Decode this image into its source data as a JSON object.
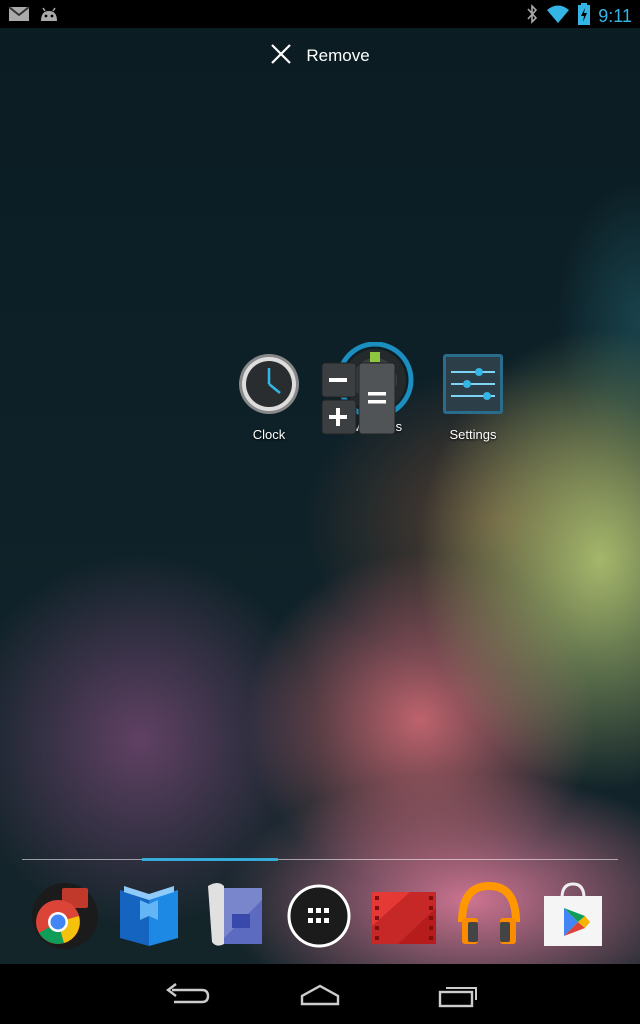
{
  "status_bar": {
    "time": "9:11",
    "left_icons": [
      "gmail-icon",
      "android-debug-icon"
    ],
    "right_icons": [
      "bluetooth-icon",
      "wifi-icon",
      "battery-charging-icon"
    ]
  },
  "remove_bar": {
    "label": "Remove",
    "icon": "close-icon"
  },
  "home_apps": [
    {
      "label": "Clock",
      "icon": "clock-icon"
    },
    {
      "label": "Downloads",
      "icon": "downloads-icon"
    },
    {
      "label": "Settings",
      "icon": "settings-icon"
    }
  ],
  "dragged_item": {
    "icon": "calculator-icon"
  },
  "dock": [
    {
      "name": "chrome-icon"
    },
    {
      "name": "play-books-icon"
    },
    {
      "name": "play-magazines-icon"
    },
    {
      "name": "all-apps-icon"
    },
    {
      "name": "play-movies-icon"
    },
    {
      "name": "play-music-icon"
    },
    {
      "name": "play-store-icon"
    }
  ],
  "nav": [
    "back-icon",
    "home-icon",
    "recent-apps-icon"
  ],
  "colors": {
    "accent": "#33b5e5",
    "statusbar_bg": "#000000",
    "navbar_bg": "#000000"
  }
}
